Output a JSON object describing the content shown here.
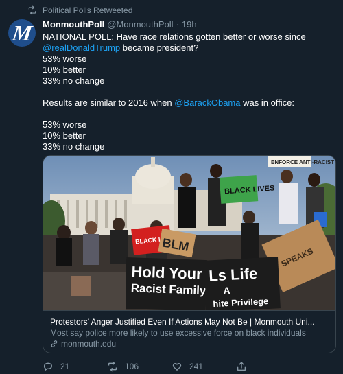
{
  "retweet": {
    "label": "Political Polls Retweeted"
  },
  "author": {
    "display_name": "MonmouthPoll",
    "handle": "@MonmouthPoll",
    "separator": "·",
    "time": "19h",
    "avatar_letter": "M"
  },
  "tweet": {
    "line1": "NATIONAL POLL: Have race relations gotten better or worse since",
    "mention1": "@realDonaldTrump",
    "line2_rest": " became president?",
    "stat1": "53% worse",
    "stat2": "10% better",
    "stat3": "33% no change",
    "line_results_pre": "Results are similar to 2016 when ",
    "mention2": "@BarackObama",
    "line_results_post": " was in office:",
    "stat4": "53% worse",
    "stat5": "10% better",
    "stat6": "33% no change"
  },
  "card": {
    "title": "Protestors’ Anger Justified Even If Actions May Not Be | Monmouth Uni...",
    "description": "Most say police more likely to use excessive force on black individuals",
    "domain": "monmouth.edu",
    "image_signs": [
      "Hold Your Racist Family",
      "Ls Life A White Privilege",
      "BLM",
      "BLACK LIVES MATTER",
      "ENFORCE ANTI-RACIST POLICIES"
    ],
    "image_sign_colors": {
      "green": "#3ea34a",
      "red": "#d3201f",
      "cardboard": "#b98a58"
    }
  },
  "actions": {
    "reply_count": "21",
    "retweet_count": "106",
    "like_count": "241"
  },
  "colors": {
    "background": "#15202b",
    "muted": "#8899a6",
    "accent": "#1da1f2",
    "border": "#38444d"
  }
}
